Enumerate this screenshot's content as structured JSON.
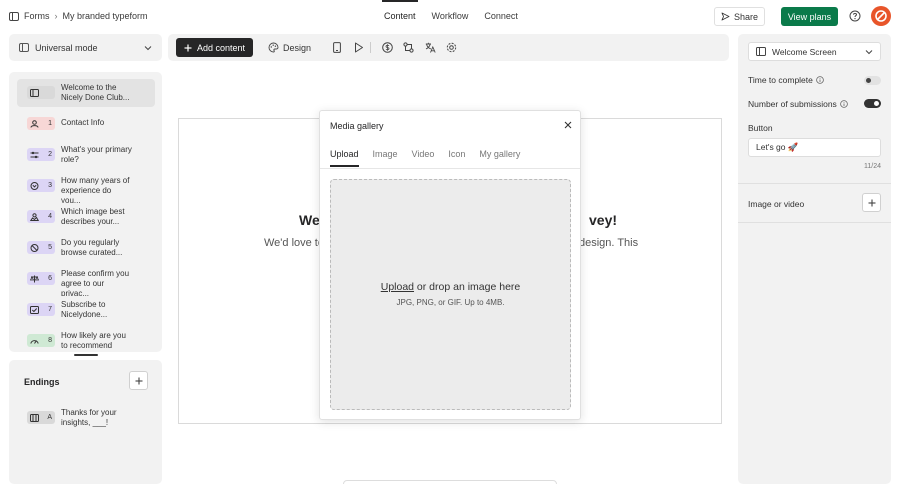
{
  "topbar": {
    "breadcrumb_root": "Forms",
    "breadcrumb_current": "My branded typeform",
    "tabs": [
      {
        "label": "Content",
        "active": true
      },
      {
        "label": "Workflow",
        "active": false
      },
      {
        "label": "Connect",
        "active": false
      }
    ],
    "share_label": "Share",
    "plans_label": "View plans"
  },
  "sidebar": {
    "mode_label": "Universal mode",
    "questions": [
      {
        "badge": "",
        "label": "Welcome to the Nicely Done Club...",
        "icon": "welcome-screen-icon",
        "color": "grey"
      },
      {
        "badge": "1",
        "label": "Contact Info",
        "icon": "contact-info-icon",
        "color": "pink"
      },
      {
        "badge": "2",
        "label": "What's your primary role?",
        "icon": "multiple-choice-icon",
        "color": "purple"
      },
      {
        "badge": "3",
        "label": "How many years of experience do you...",
        "icon": "dropdown-icon",
        "color": "purple"
      },
      {
        "badge": "4",
        "label": "Which image best describes your...",
        "icon": "picture-choice-icon",
        "color": "purple"
      },
      {
        "badge": "5",
        "label": "Do you regularly browse curated...",
        "icon": "yes-no-icon",
        "color": "purple"
      },
      {
        "badge": "6",
        "label": "Please confirm you agree to our privac...",
        "icon": "legal-icon",
        "color": "purple"
      },
      {
        "badge": "7",
        "label": "Subscribe to Nicelydone...",
        "icon": "checkbox-icon",
        "color": "purple"
      },
      {
        "badge": "8",
        "label": "How likely are you to recommend Nicely...",
        "icon": "nps-icon",
        "color": "green"
      }
    ],
    "endings_title": "Endings",
    "endings": [
      {
        "badge": "A",
        "label": "Thanks for your insights, ___!",
        "icon": "ending-screen-icon"
      }
    ]
  },
  "toolbar": {
    "add_content_label": "Add content",
    "design_label": "Design"
  },
  "preview": {
    "heading_left": "Wel",
    "heading_right": "vey!",
    "body_left": "We'd love to",
    "body_right": "design. This"
  },
  "modal": {
    "title": "Media gallery",
    "tabs": [
      {
        "label": "Upload",
        "active": true
      },
      {
        "label": "Image",
        "active": false
      },
      {
        "label": "Video",
        "active": false
      },
      {
        "label": "Icon",
        "active": false
      },
      {
        "label": "My gallery",
        "active": false
      }
    ],
    "upload_link": "Upload",
    "drop_text": " or drop an image here",
    "file_hint": "JPG, PNG, or GIF. Up to 4MB."
  },
  "settings": {
    "screen_type": "Welcome Screen",
    "time_to_complete_label": "Time to complete",
    "time_to_complete_on": false,
    "submissions_label": "Number of submissions",
    "submissions_on": true,
    "button_section_label": "Button",
    "button_text": "Let's go 🚀",
    "button_counter": "11/24",
    "image_video_label": "Image or video"
  }
}
